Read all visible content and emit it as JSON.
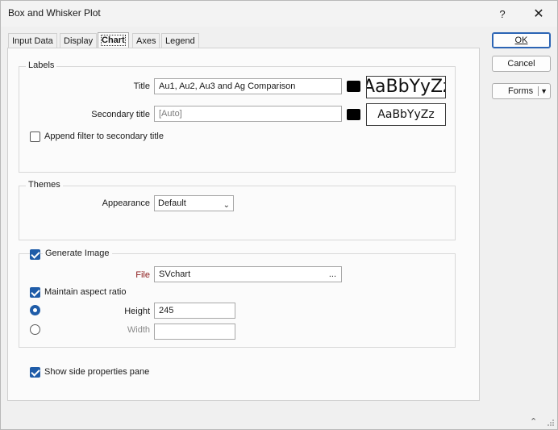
{
  "window": {
    "title": "Box and Whisker Plot",
    "help_glyph": "?",
    "close_glyph": "✕"
  },
  "tabs": [
    {
      "label": "Input Data",
      "active": false
    },
    {
      "label": "Display",
      "active": false
    },
    {
      "label": "Chart",
      "active": true
    },
    {
      "label": "Axes",
      "active": false
    },
    {
      "label": "Legend",
      "active": false
    }
  ],
  "labels_group": {
    "title": "Labels",
    "title_label": "Title",
    "title_value": "Au1, Au2, Au3 and Ag Comparison",
    "title_font_preview": "AaBbYyZz",
    "secondary_label": "Secondary title",
    "secondary_placeholder": "[Auto]",
    "secondary_font_preview": "AaBbYyZz",
    "append_filter_label": "Append filter to secondary title",
    "append_filter_checked": false,
    "swatch_color": "#000000"
  },
  "themes_group": {
    "title": "Themes",
    "appearance_label": "Appearance",
    "appearance_value": "Default"
  },
  "image_group": {
    "generate_label": "Generate Image",
    "generate_checked": true,
    "file_label": "File",
    "file_value": "SVchart",
    "file_browse": "...",
    "maintain_label": "Maintain aspect ratio",
    "maintain_checked": true,
    "height_label": "Height",
    "height_value": "245",
    "height_selected": true,
    "width_label": "Width",
    "width_value": "",
    "width_selected": false
  },
  "side_pane": {
    "label": "Show side properties pane",
    "checked": true
  },
  "buttons": {
    "ok": "OK",
    "cancel": "Cancel",
    "forms": "Forms"
  },
  "colors": {
    "accent": "#1f5ca8",
    "file_label": "#8b1a1a"
  }
}
